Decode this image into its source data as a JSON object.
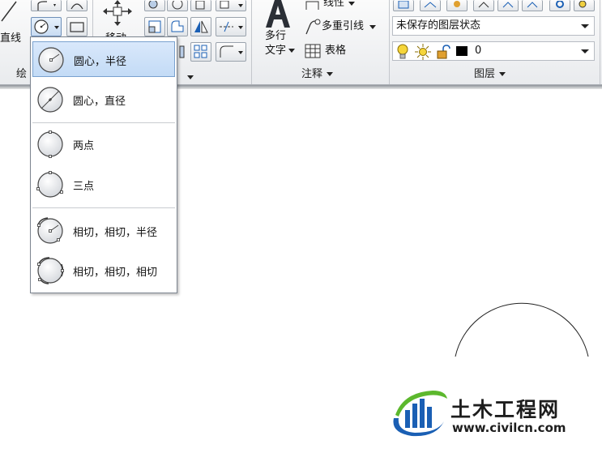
{
  "ribbon": {
    "draw_panel": {
      "title": "绘",
      "line_label": "直线"
    },
    "modify_panel": {
      "move_label": "移动"
    },
    "annotation_panel": {
      "title": "注释",
      "mtext_line1": "多行",
      "mtext_line2": "文字",
      "linear_label": "线性",
      "multileader_label": "多重引线",
      "table_label": "表格"
    },
    "layers_panel": {
      "title": "图层",
      "layer_state": "未保存的图层状态",
      "current_layer": "0"
    }
  },
  "circle_menu": {
    "items": [
      {
        "label": "圆心，半径",
        "icon": "circle-center-radius-icon"
      },
      {
        "label": "圆心，直径",
        "icon": "circle-center-diameter-icon"
      },
      {
        "label": "两点",
        "icon": "circle-two-point-icon"
      },
      {
        "label": "三点",
        "icon": "circle-three-point-icon"
      },
      {
        "label": "相切，相切，半径",
        "icon": "circle-tan-tan-radius-icon"
      },
      {
        "label": "相切，相切，相切",
        "icon": "circle-tan-tan-tan-icon"
      }
    ]
  },
  "watermark": {
    "name": "土木工程网",
    "url": "www.civilcn.com"
  },
  "colors": {
    "highlight": "#c3dbf6",
    "highlight_border": "#7aa2cf",
    "logo_blue": "#1a5fb4",
    "logo_green": "#5cb82d"
  }
}
